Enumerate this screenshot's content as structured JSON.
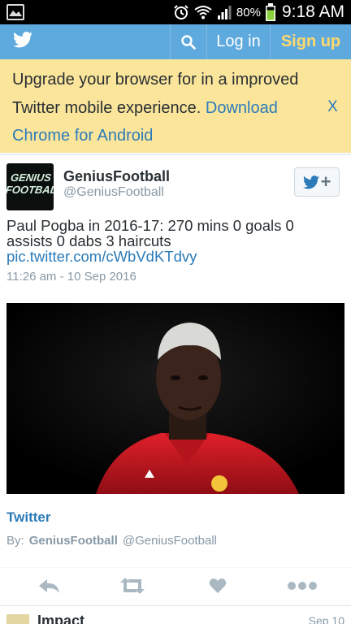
{
  "status_bar": {
    "battery_percent": "80%",
    "time": "9:18 AM"
  },
  "header": {
    "login_label": "Log in",
    "signup_label": "Sign up"
  },
  "banner": {
    "text": "Upgrade your browser for in a improved Twitter mobile experience.",
    "link_text": "Download Chrome for Android",
    "close_label": "X"
  },
  "tweet": {
    "display_name": "GeniusFootball",
    "handle": "@GeniusFootball",
    "avatar_text": "GENIUS FOOTBALL",
    "text": "Paul Pogba in 2016-17: 270 mins 0 goals 0 assists 0 dabs 3 haircuts",
    "link": "pic.twitter.com/cWbVdKTdvy",
    "timestamp": "11:26 am - 10 Sep 2016",
    "card_source": "Twitter",
    "card_by_label": "By:",
    "card_by_name": "GeniusFootball",
    "card_by_handle": "@GeniusFootball"
  },
  "actions": {
    "reply_icon": "reply-icon",
    "retweet_icon": "retweet-icon",
    "like_icon": "heart-icon",
    "more_icon": "more-icon"
  },
  "next_tweet": {
    "display_name": "Impact",
    "date": "Sep 10"
  },
  "colors": {
    "header": "#5ea9dd",
    "banner": "#fbe59b",
    "link": "#2b7bb9",
    "signup": "#ffd96b"
  }
}
